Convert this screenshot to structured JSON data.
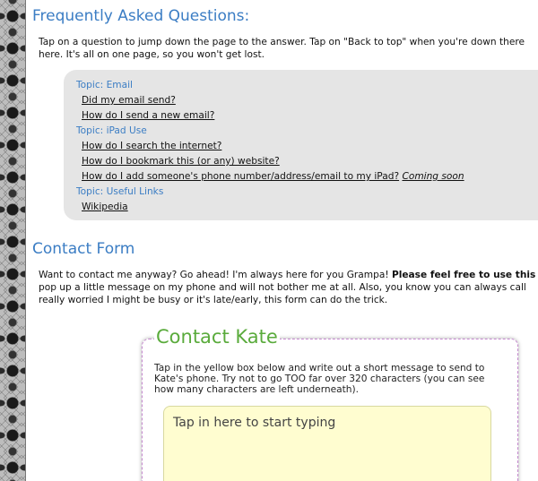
{
  "faq": {
    "heading": "Frequently Asked Questions:",
    "intro_line1": "Tap on a question to jump down the page to the answer. Tap on \"Back to top\" when you're down there",
    "intro_line2": "here. It's all on one page, so you won't get lost.",
    "topics": [
      {
        "label": "Topic: Email",
        "questions": [
          "Did my email send?",
          "How do I send a new email?"
        ]
      },
      {
        "label": "Topic: iPad Use",
        "questions": [
          "How do I search the internet?",
          "How do I bookmark this (or any) website?",
          "How do I add someone's phone number/address/email to my iPad?"
        ]
      },
      {
        "label": "Topic: Useful Links",
        "questions": [
          "Wikipedia"
        ]
      }
    ],
    "coming_soon": "Coming soon"
  },
  "contact": {
    "heading": "Contact Form",
    "intro_line1_a": "Want to contact me anyway? Go ahead! I'm always here for you Grampa! ",
    "intro_line1_b": "Please feel free to use this f",
    "intro_line2": "pop up a little message on my phone and will not bother me at all. Also, you know you can always call",
    "intro_line3": "really worried I might be busy or it's late/early, this form can do the trick.",
    "form_title": "Contact Kate",
    "form_instructions": "Tap in the yellow box below and write out a short message to send to Kate's phone. Try not to go TOO far over 320 characters (you can see how many characters are left underneath).",
    "message_placeholder": "Tap in here to start typing"
  },
  "colors": {
    "heading_blue": "#3b7dc4",
    "legend_green": "#5aab3c",
    "faq_box_bg": "#e5e5e5",
    "textarea_bg": "#fffdd0"
  }
}
